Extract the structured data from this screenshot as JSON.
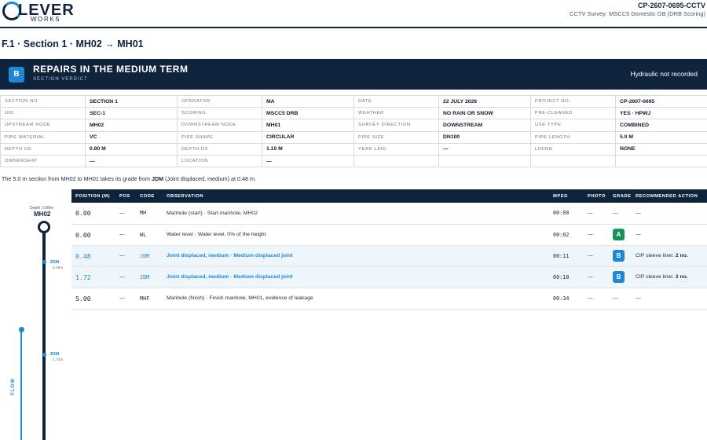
{
  "brand": {
    "logo_text": "LEVER",
    "logo_sub": "WORKS"
  },
  "header": {
    "project_code": "CP-2607-0695-CCTV",
    "survey_title": "CCTV Survey: MSCC5 Domestic GB (DRB Scoring)"
  },
  "page_title": "F.1 · Section 1 · MH02 → MH01",
  "verdict": {
    "badge": "B",
    "title": "REPAIRS IN THE MEDIUM TERM",
    "subtitle": "SECTION VERDICT",
    "right_text": "Hydraulic not recorded"
  },
  "meta": {
    "rows": [
      [
        [
          "SECTION NO.",
          "SECTION 1"
        ],
        [
          "OPERATOR",
          "MA"
        ],
        [
          "DATE",
          "22 JULY 2026"
        ],
        [
          "PROJECT NO.",
          "CP-2607-0695"
        ]
      ],
      [
        [
          "UID",
          "SEC-1"
        ],
        [
          "SCORING",
          "MSCC5 DRB"
        ],
        [
          "WEATHER",
          "NO RAIN OR SNOW"
        ],
        [
          "PRE-CLEANED",
          "YES · HPWJ"
        ]
      ],
      [
        [
          "UPSTREAM NODE",
          "MH02"
        ],
        [
          "DOWNSTREAM NODE",
          "MH01"
        ],
        [
          "SURVEY DIRECTION",
          "DOWNSTREAM"
        ],
        [
          "USE TYPE",
          "COMBINED"
        ]
      ],
      [
        [
          "PIPE MATERIAL",
          "VC"
        ],
        [
          "PIPE SHAPE",
          "CIRCULAR"
        ],
        [
          "PIPE SIZE",
          "DN100"
        ],
        [
          "PIPE LENGTH",
          "5.0 M"
        ]
      ],
      [
        [
          "DEPTH US",
          "0.80 M"
        ],
        [
          "DEPTH DS",
          "1.10 M"
        ],
        [
          "YEAR LAID",
          "—"
        ],
        [
          "LINING",
          "NONE"
        ]
      ],
      [
        [
          "OWNERSHIP",
          "—"
        ],
        [
          "LOCATION",
          "—"
        ],
        [
          "",
          ""
        ],
        [
          "",
          ""
        ]
      ]
    ]
  },
  "summary": {
    "prefix": "The 5.0 m section from MH02 to MH01 takes its grade from ",
    "code": "JDM",
    "suffix": " (Joint displaced, medium) at 0.48 m."
  },
  "observations": {
    "headers": [
      "POSITION (M)",
      "POS",
      "CODE",
      "OBSERVATION",
      "MPEG",
      "PHOTO",
      "GRADE",
      "RECOMMENDED ACTION"
    ],
    "rows": [
      {
        "position": "0.00",
        "pos": "—",
        "code": "MH",
        "observation": "Manhole (start) · Start manhole, MH02",
        "mpeg": "00:00",
        "photo": "—",
        "grade": "—",
        "action": "—",
        "action_bold": ""
      },
      {
        "position": "0.00",
        "pos": "—",
        "code": "WL",
        "observation": "Water level · Water level, 0% of the height",
        "mpeg": "00:02",
        "photo": "—",
        "grade": "A",
        "action": "—",
        "action_bold": ""
      },
      {
        "position": "0.48",
        "pos": "—",
        "code": "JDM",
        "observation": "Joint displaced, medium · Medium displaced joint",
        "mpeg": "00:11",
        "photo": "—",
        "grade": "B",
        "action": "CIP sleeve liner. ",
        "action_bold": "2 no."
      },
      {
        "position": "1.72",
        "pos": "—",
        "code": "JDM",
        "observation": "Joint displaced, medium · Medium displaced joint",
        "mpeg": "00:18",
        "photo": "—",
        "grade": "B",
        "action": "CIP sleeve liner. ",
        "action_bold": "2 no."
      },
      {
        "position": "5.00",
        "pos": "—",
        "code": "MHF",
        "observation": "Manhole (finish) · Finish manhole, MH01, evidence of leakage",
        "mpeg": "00:34",
        "photo": "—",
        "grade": "—",
        "action": "—",
        "action_bold": ""
      }
    ]
  },
  "diagram": {
    "start_depth": "Depth: 0.80m",
    "start_node": "MH02",
    "flow_label": "FLOW",
    "defects": [
      {
        "code": "JDM",
        "pos": "0.48m"
      },
      {
        "code": "JDM",
        "pos": "1.72m"
      }
    ]
  },
  "colors": {
    "navy": "#10233d",
    "accent": "#1e88d6",
    "grade_a": "#15935a",
    "grade_b": "#1e88d6"
  },
  "icons": [
    "clever-works-logo",
    "flow-arrow-icon"
  ]
}
